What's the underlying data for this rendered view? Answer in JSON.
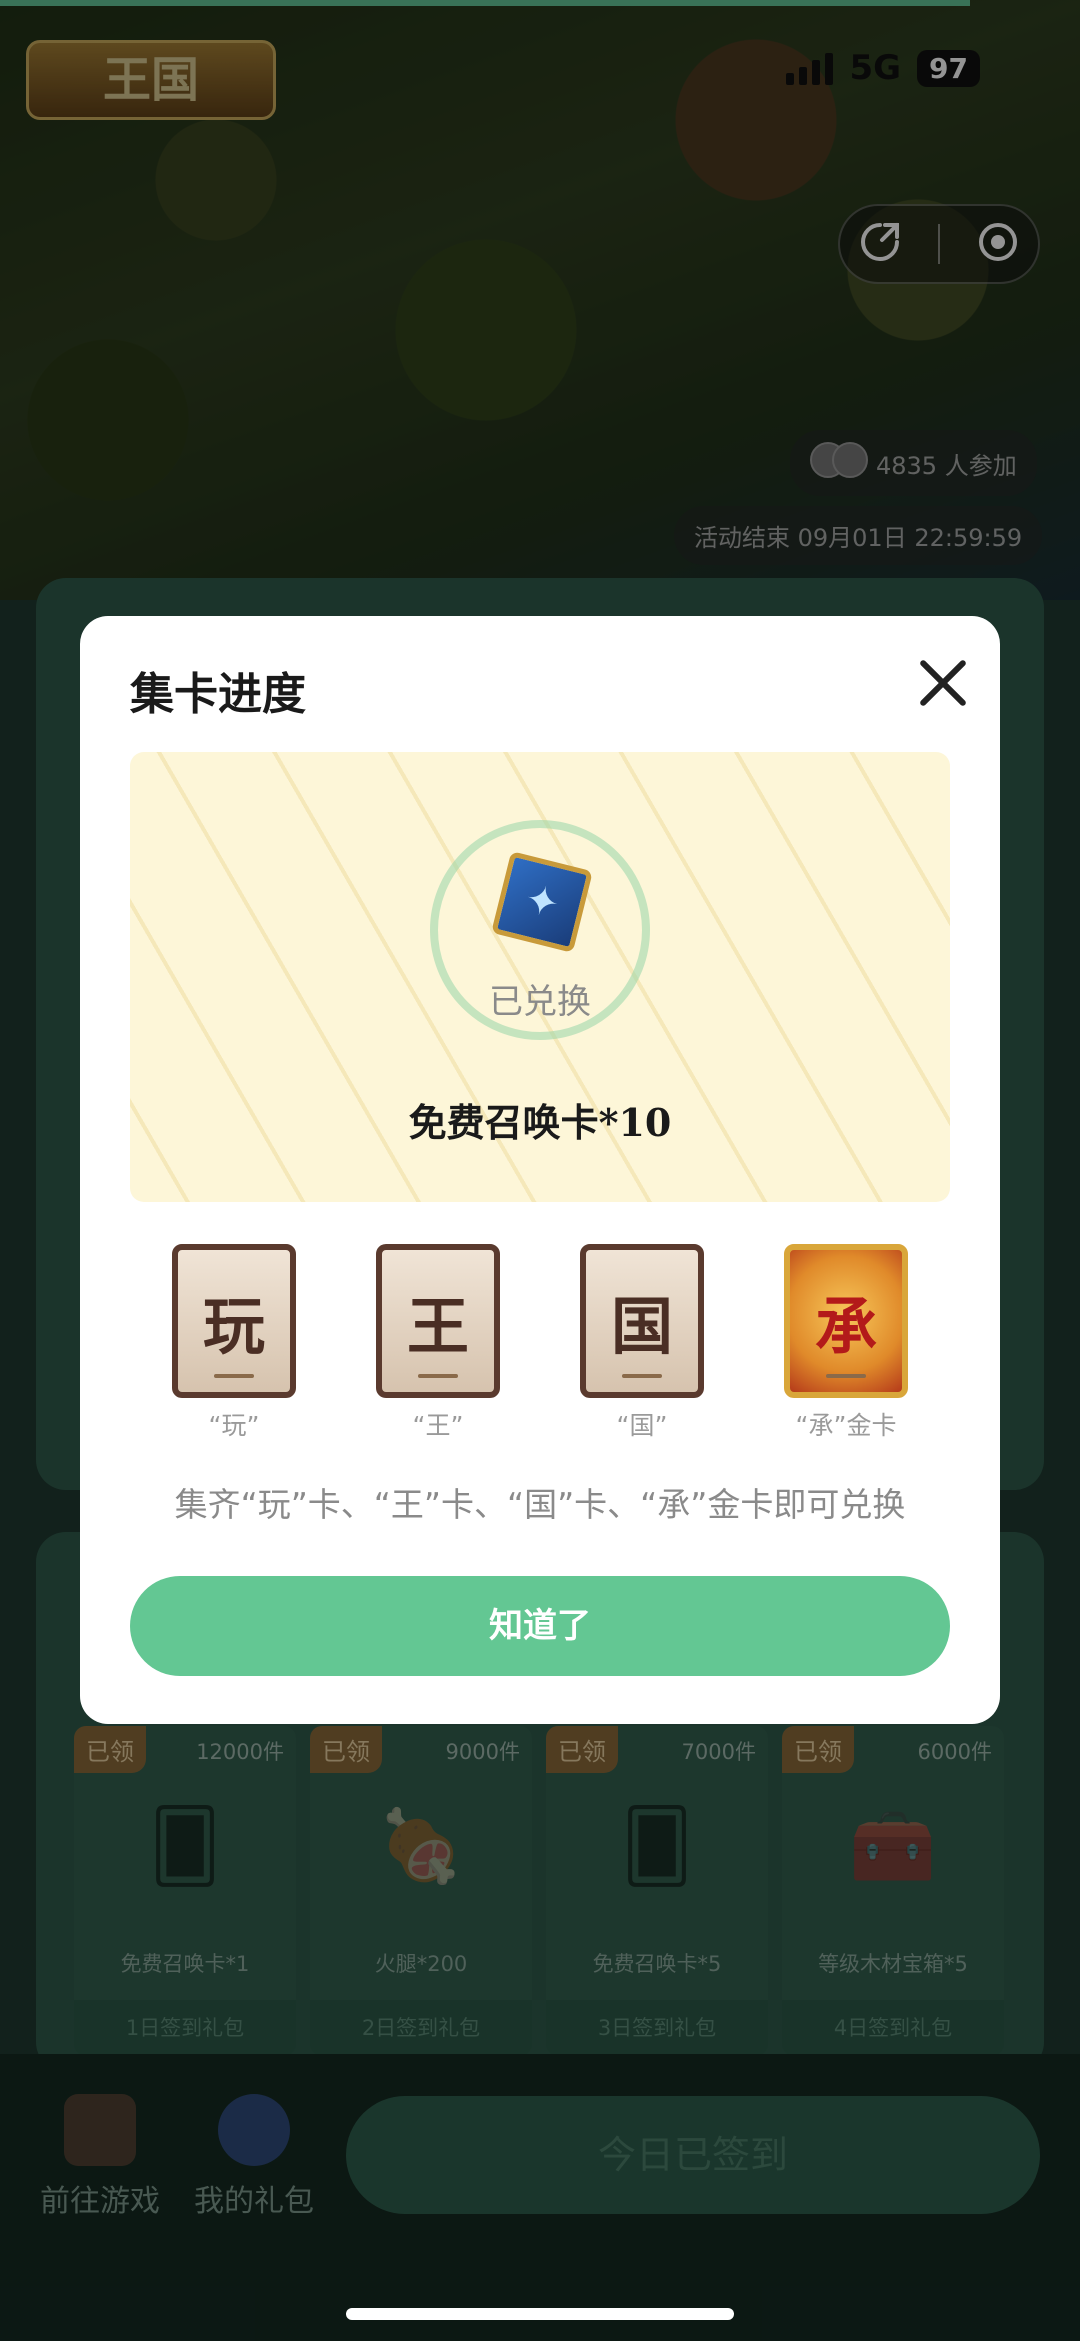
{
  "status_bar": {
    "network": "5G",
    "battery": "97"
  },
  "game": {
    "participants": "4835 人参加",
    "end_time": "活动结束 09月01日 22:59:59"
  },
  "rewards": [
    {
      "tag": "已领",
      "count": "12000件",
      "name": "免费召唤卡*1",
      "footer": "1日签到礼包",
      "icon": "summon-card-icon"
    },
    {
      "tag": "已领",
      "count": "9000件",
      "name": "火腿*200",
      "footer": "2日签到礼包",
      "icon": "ham-icon"
    },
    {
      "tag": "已领",
      "count": "7000件",
      "name": "免费召唤卡*5",
      "footer": "3日签到礼包",
      "icon": "summon-card-icon"
    },
    {
      "tag": "已领",
      "count": "6000件",
      "name": "等级木材宝箱*5",
      "footer": "4日签到礼包",
      "icon": "treasure-chest-icon"
    }
  ],
  "bottom_nav": {
    "go_game": "前往游戏",
    "my_gifts": "我的礼包",
    "signed_button": "今日已签到"
  },
  "modal": {
    "title": "集卡进度",
    "prize_status": "已兑换",
    "prize_name": "免费召唤卡*10",
    "cards": [
      {
        "glyph": "玩",
        "label": "“玩”"
      },
      {
        "glyph": "王",
        "label": "“王”"
      },
      {
        "glyph": "国",
        "label": "“国”"
      },
      {
        "glyph": "承",
        "label": "“承”金卡"
      }
    ],
    "hint": "集齐“玩”卡、“王”卡、“国”卡、“承”金卡即可兑换",
    "ok_button": "知道了"
  },
  "colors": {
    "accent": "#63c793",
    "modal_bg": "#ffffff",
    "prize_panel_bg": "#fdf6d8"
  }
}
